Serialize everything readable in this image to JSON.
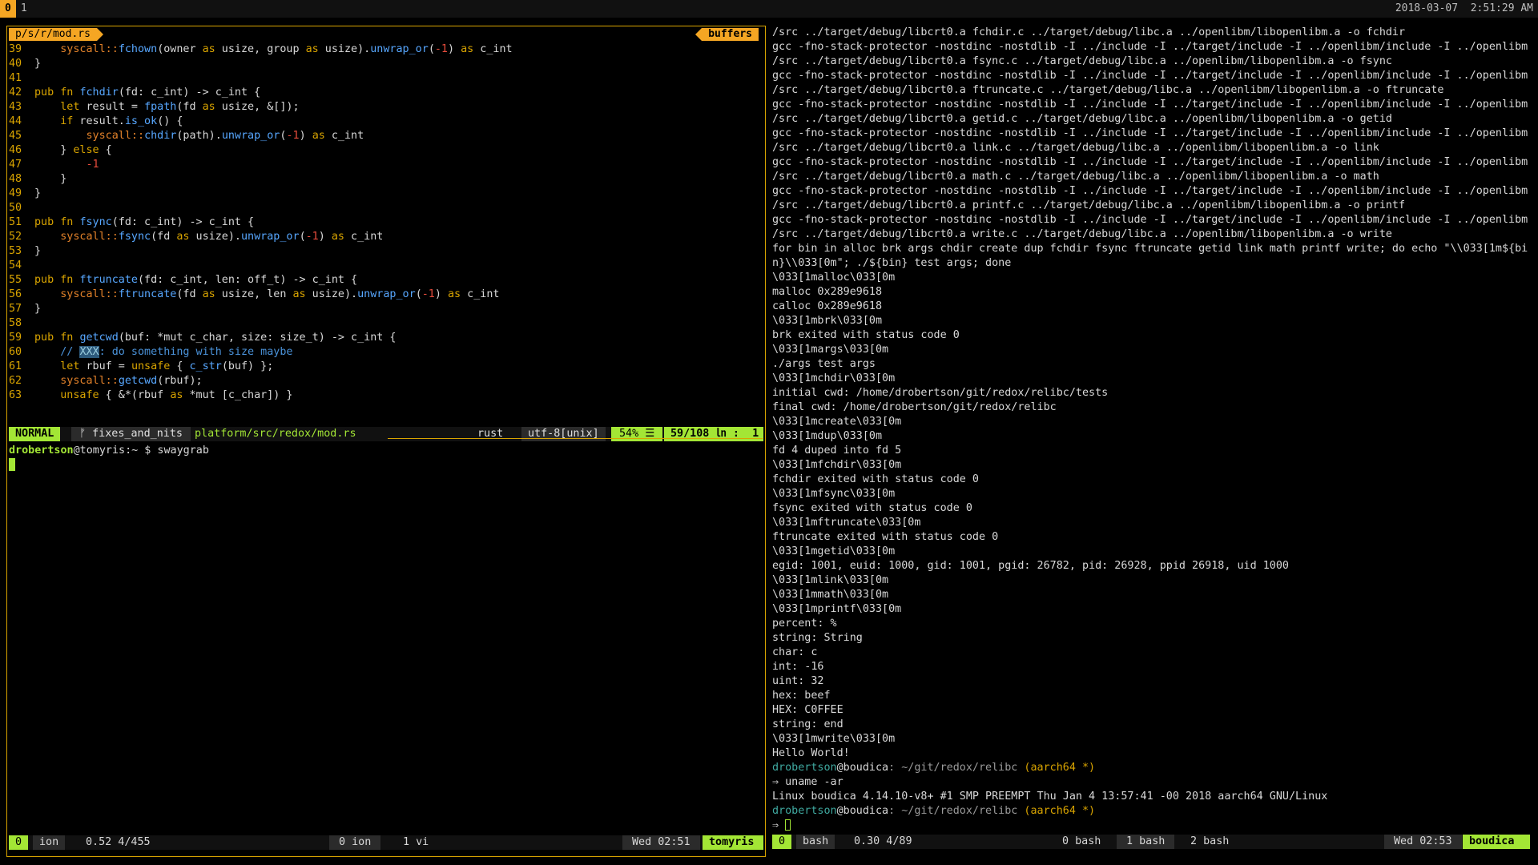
{
  "topbar": {
    "workspace_active": "0",
    "workspace_other": "1",
    "datetime": "2018-03-07  2:51:29 AM"
  },
  "vim": {
    "file_tab": "p/s/r/mod.rs",
    "buffers_label": "buffers",
    "code": [
      {
        "n": "39",
        "t": "    syscall::fchown(owner as usize, group as usize).unwrap_or(-1) as c_int"
      },
      {
        "n": "40",
        "t": "}"
      },
      {
        "n": "41",
        "t": ""
      },
      {
        "n": "42",
        "t": "pub fn fchdir(fd: c_int) -> c_int {"
      },
      {
        "n": "43",
        "t": "    let result = fpath(fd as usize, &[]);"
      },
      {
        "n": "44",
        "t": "    if result.is_ok() {"
      },
      {
        "n": "45",
        "t": "        syscall::chdir(path).unwrap_or(-1) as c_int"
      },
      {
        "n": "46",
        "t": "    } else {"
      },
      {
        "n": "47",
        "t": "        -1"
      },
      {
        "n": "48",
        "t": "    }"
      },
      {
        "n": "49",
        "t": "}"
      },
      {
        "n": "50",
        "t": ""
      },
      {
        "n": "51",
        "t": "pub fn fsync(fd: c_int) -> c_int {"
      },
      {
        "n": "52",
        "t": "    syscall::fsync(fd as usize).unwrap_or(-1) as c_int"
      },
      {
        "n": "53",
        "t": "}"
      },
      {
        "n": "54",
        "t": ""
      },
      {
        "n": "55",
        "t": "pub fn ftruncate(fd: c_int, len: off_t) -> c_int {"
      },
      {
        "n": "56",
        "t": "    syscall::ftruncate(fd as usize, len as usize).unwrap_or(-1) as c_int"
      },
      {
        "n": "57",
        "t": "}"
      },
      {
        "n": "58",
        "t": ""
      },
      {
        "n": "59",
        "t": "pub fn getcwd(buf: *mut c_char, size: size_t) -> c_int {"
      },
      {
        "n": "60",
        "t": "    // XXX: do something with size maybe"
      },
      {
        "n": "61",
        "t": "    let rbuf = unsafe { c_str(buf) };"
      },
      {
        "n": "62",
        "t": "    syscall::getcwd(rbuf);"
      },
      {
        "n": "63",
        "t": "    unsafe { &*(rbuf as *mut [c_char]) }"
      }
    ],
    "status": {
      "mode": "NORMAL",
      "branch": "ᚠ fixes_and_nits",
      "path": "platform/src/redox/mod.rs",
      "filetype": "rust",
      "encoding": "utf-8[unix]",
      "percent": "54% ☰",
      "position": "59/108 ㏑ :  1"
    }
  },
  "left_shell": {
    "user": "drobertson",
    "host": "@tomyris",
    "prompt_rest": ":~ $ swaygrab"
  },
  "tmux_left": {
    "session": "0",
    "window_name": "ion",
    "load": "0.52 4/455",
    "win0": "0 ion",
    "win1": "1 vi",
    "time": "Wed 02:51",
    "host": "tomyris"
  },
  "terminal": {
    "lines": [
      "/src ../target/debug/libcrt0.a fchdir.c ../target/debug/libc.a ../openlibm/libopenlibm.a -o fchdir",
      "gcc -fno-stack-protector -nostdinc -nostdlib -I ../include -I ../target/include -I ../openlibm/include -I ../openlibm",
      "/src ../target/debug/libcrt0.a fsync.c ../target/debug/libc.a ../openlibm/libopenlibm.a -o fsync",
      "gcc -fno-stack-protector -nostdinc -nostdlib -I ../include -I ../target/include -I ../openlibm/include -I ../openlibm",
      "/src ../target/debug/libcrt0.a ftruncate.c ../target/debug/libc.a ../openlibm/libopenlibm.a -o ftruncate",
      "gcc -fno-stack-protector -nostdinc -nostdlib -I ../include -I ../target/include -I ../openlibm/include -I ../openlibm",
      "/src ../target/debug/libcrt0.a getid.c ../target/debug/libc.a ../openlibm/libopenlibm.a -o getid",
      "gcc -fno-stack-protector -nostdinc -nostdlib -I ../include -I ../target/include -I ../openlibm/include -I ../openlibm",
      "/src ../target/debug/libcrt0.a link.c ../target/debug/libc.a ../openlibm/libopenlibm.a -o link",
      "gcc -fno-stack-protector -nostdinc -nostdlib -I ../include -I ../target/include -I ../openlibm/include -I ../openlibm",
      "/src ../target/debug/libcrt0.a math.c ../target/debug/libc.a ../openlibm/libopenlibm.a -o math",
      "gcc -fno-stack-protector -nostdinc -nostdlib -I ../include -I ../target/include -I ../openlibm/include -I ../openlibm",
      "/src ../target/debug/libcrt0.a printf.c ../target/debug/libc.a ../openlibm/libopenlibm.a -o printf",
      "gcc -fno-stack-protector -nostdinc -nostdlib -I ../include -I ../target/include -I ../openlibm/include -I ../openlibm",
      "/src ../target/debug/libcrt0.a write.c ../target/debug/libc.a ../openlibm/libopenlibm.a -o write",
      "for bin in alloc brk args chdir create dup fchdir fsync ftruncate getid link math printf write; do echo \"\\\\033[1m${bi",
      "n}\\\\033[0m\"; ./${bin} test args; done",
      "\\033[1malloc\\033[0m",
      "malloc 0x289e9618",
      "calloc 0x289e9618",
      "\\033[1mbrk\\033[0m",
      "brk exited with status code 0",
      "\\033[1margs\\033[0m",
      "./args test args",
      "\\033[1mchdir\\033[0m",
      "initial cwd: /home/drobertson/git/redox/relibc/tests",
      "final cwd: /home/drobertson/git/redox/relibc",
      "\\033[1mcreate\\033[0m",
      "\\033[1mdup\\033[0m",
      "fd 4 duped into fd 5",
      "\\033[1mfchdir\\033[0m",
      "fchdir exited with status code 0",
      "\\033[1mfsync\\033[0m",
      "fsync exited with status code 0",
      "\\033[1mftruncate\\033[0m",
      "ftruncate exited with status code 0",
      "\\033[1mgetid\\033[0m",
      "egid: 1001, euid: 1000, gid: 1001, pgid: 26782, pid: 26928, ppid 26918, uid 1000",
      "\\033[1mlink\\033[0m",
      "\\033[1mmath\\033[0m",
      "\\033[1mprintf\\033[0m",
      "percent: %",
      "string: String",
      "char: c",
      "int: -16",
      "uint: 32",
      "hex: beef",
      "HEX: C0FFEE",
      "string: end",
      "\\033[1mwrite\\033[0m",
      "Hello World!"
    ],
    "prompt_user": "drobertson",
    "prompt_host": "@boudica",
    "prompt_path": ": ~/git/redox/relibc",
    "prompt_branch": " (aarch64 *)",
    "cmd": "⇒ uname -ar",
    "uname_out": "Linux boudica 4.14.10-v8+ #1 SMP PREEMPT Thu Jan 4 13:57:41 -00 2018 aarch64 GNU/Linux",
    "prompt_arrow": "⇒ "
  },
  "tmux_right": {
    "session": "0",
    "window_name": "bash",
    "load": "0.30 4/89",
    "win0": "0 bash",
    "win1": "1 bash",
    "win2": "2 bash",
    "time": "Wed 02:53",
    "host": "boudica"
  }
}
